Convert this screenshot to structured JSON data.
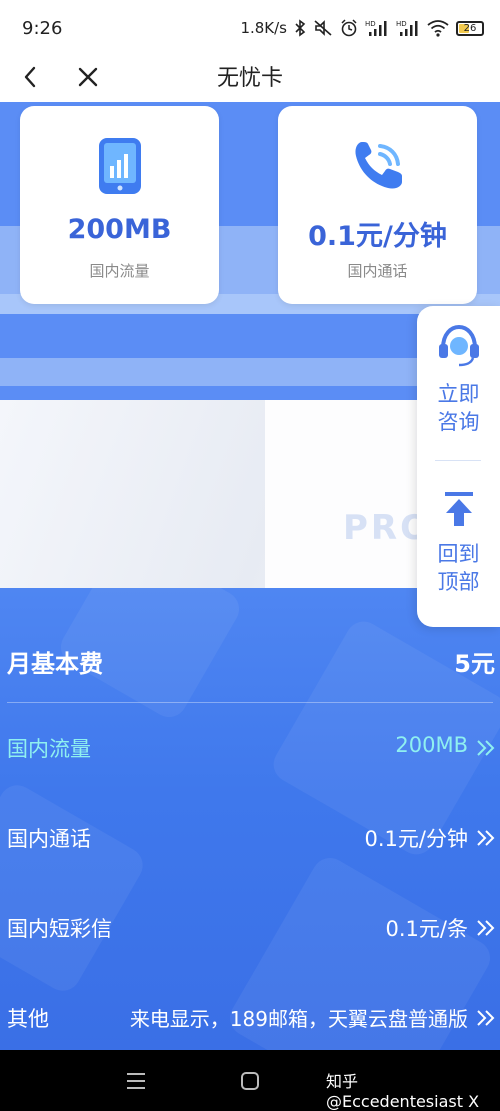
{
  "status_bar": {
    "time": "9:26",
    "speed": "1.8K/s",
    "battery": "26",
    "icons": [
      "bluetooth-icon",
      "mute-icon",
      "alarm-icon",
      "hd-signal-icon",
      "hd-signal-icon",
      "wifi-icon",
      "battery-icon"
    ]
  },
  "nav": {
    "title": "无忧卡",
    "back_icon": "chevron-left-icon",
    "close_icon": "close-icon"
  },
  "cards": [
    {
      "value": "200MB",
      "label": "国内流量",
      "icon": "phone-data-icon"
    },
    {
      "value": "0.1元/分钟",
      "label": "国内通话",
      "icon": "phone-call-icon"
    }
  ],
  "banner": {
    "text": "PRO"
  },
  "float_panel": {
    "consult_label_1": "立即",
    "consult_label_2": "咨询",
    "top_label_1": "回到",
    "top_label_2": "顶部"
  },
  "plan": {
    "monthly_fee_label": "月基本费",
    "monthly_fee_value": "5元",
    "rows": [
      {
        "label": "国内流量",
        "value": "200MB",
        "highlight": true
      },
      {
        "label": "国内通话",
        "value": "0.1元/分钟",
        "highlight": false
      },
      {
        "label": "国内短彩信",
        "value": "0.1元/条",
        "highlight": false
      },
      {
        "label": "其他",
        "value": "来电显示，189邮箱，天翼云盘普通版",
        "highlight": false
      }
    ]
  },
  "colors": {
    "accent": "#3a64d8",
    "plan_bg": "#4580ef",
    "highlight_text": "#8ff0f0"
  },
  "watermark": "知乎 @Eccedentesiast X"
}
